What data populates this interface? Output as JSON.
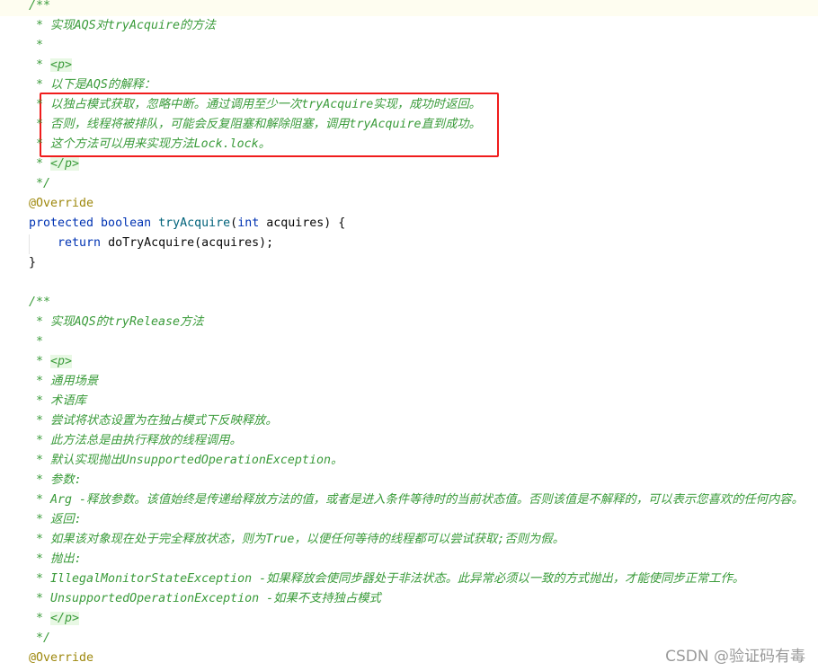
{
  "colors": {
    "comment": "#3a9b3a",
    "keyword": "#0033b3",
    "method": "#00627a",
    "annotation": "#9e880d",
    "highlight_box": "#f01c1c"
  },
  "lines": [
    [
      [
        "c",
        "/**"
      ]
    ],
    [
      [
        "c",
        " * 实现AQS对tryAcquire的方法"
      ]
    ],
    [
      [
        "c",
        " *"
      ]
    ],
    [
      [
        "c",
        " * "
      ],
      [
        "tag",
        "<p>"
      ]
    ],
    [
      [
        "c",
        " * 以下是AQS的解释："
      ]
    ],
    [
      [
        "c",
        " * 以独占模式获取，忽略中断。通过调用至少一次tryAcquire实现，成功时返回。"
      ]
    ],
    [
      [
        "c",
        " * 否则，线程将被排队，可能会反复阻塞和解除阻塞，调用tryAcquire直到成功。"
      ]
    ],
    [
      [
        "c",
        " * 这个方法可以用来实现方法Lock.lock。"
      ]
    ],
    [
      [
        "c",
        " * "
      ],
      [
        "tag",
        "</p>"
      ]
    ],
    [
      [
        "c",
        " */"
      ]
    ],
    [
      [
        "ann",
        "@Override"
      ]
    ],
    [
      [
        "kw",
        "protected boolean "
      ],
      [
        "fn",
        "tryAcquire"
      ],
      [
        "p",
        "("
      ],
      [
        "kw",
        "int "
      ],
      [
        "p",
        "acquires) {"
      ]
    ],
    [
      [
        "kw",
        "    return "
      ],
      [
        "p",
        "doTryAcquire(acquires);"
      ]
    ],
    [
      [
        "p",
        "}"
      ]
    ],
    [],
    [
      [
        "c",
        "/**"
      ]
    ],
    [
      [
        "c",
        " * 实现AQS的tryRelease方法"
      ]
    ],
    [
      [
        "c",
        " *"
      ]
    ],
    [
      [
        "c",
        " * "
      ],
      [
        "tag",
        "<p>"
      ]
    ],
    [
      [
        "c",
        " * 通用场景"
      ]
    ],
    [
      [
        "c",
        " * 术语库"
      ]
    ],
    [
      [
        "c",
        " * 尝试将状态设置为在独占模式下反映释放。"
      ]
    ],
    [
      [
        "c",
        " * 此方法总是由执行释放的线程调用。"
      ]
    ],
    [
      [
        "c",
        " * 默认实现抛出UnsupportedOperationException。"
      ]
    ],
    [
      [
        "c",
        " * 参数:"
      ]
    ],
    [
      [
        "c",
        " * Arg -释放参数。该值始终是传递给释放方法的值，或者是进入条件等待时的当前状态值。否则该值是不解释的，可以表示您喜欢的任何内容。"
      ]
    ],
    [
      [
        "c",
        " * 返回:"
      ]
    ],
    [
      [
        "c",
        " * 如果该对象现在处于完全释放状态，则为True，以便任何等待的线程都可以尝试获取;否则为假。"
      ]
    ],
    [
      [
        "c",
        " * 抛出:"
      ]
    ],
    [
      [
        "c",
        " * IllegalMonitorStateException -如果释放会使同步器处于非法状态。此异常必须以一致的方式抛出，才能使同步正常工作。"
      ]
    ],
    [
      [
        "c",
        " * UnsupportedOperationException -如果不支持独占模式"
      ]
    ],
    [
      [
        "c",
        " * "
      ],
      [
        "tag",
        "</p>"
      ]
    ],
    [
      [
        "c",
        " */"
      ]
    ],
    [
      [
        "ann",
        "@Override"
      ]
    ]
  ],
  "watermark": "CSDN @验证码有毒"
}
